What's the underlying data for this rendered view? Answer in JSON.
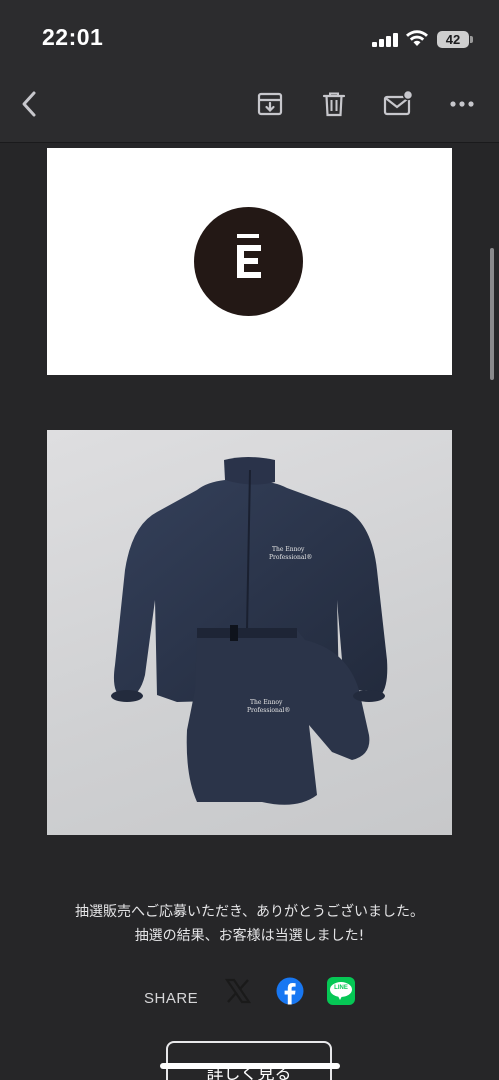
{
  "status_bar": {
    "time": "22:01",
    "battery_level": "42"
  },
  "toolbar": {
    "back_icon": "chevron-left-icon",
    "archive_icon": "archive-download-icon",
    "delete_icon": "trash-icon",
    "mark_unread_icon": "mail-unread-icon",
    "more_icon": "more-dots-icon"
  },
  "email": {
    "logo_letter": "Ē",
    "product_photo": {
      "patch_text_jacket": [
        "The Ennoy",
        "Professional®"
      ],
      "patch_text_pants": [
        "The Ennoy",
        "Professional®"
      ]
    },
    "message_line1": "抽選販売へご応募いただき、ありがとうございました。",
    "message_line2": "抽選の結果、お客様は当選しました!",
    "share_label": "SHARE",
    "share_x_icon": "x-logo-icon",
    "share_facebook_icon": "facebook-icon",
    "share_line_icon": "line-icon",
    "line_text": "LINE",
    "detail_button": "詳しく見る"
  },
  "colors": {
    "background": "#262628",
    "toolbar": "#2c2c2e",
    "facebook": "#1877f2",
    "line": "#06c755",
    "logo_circle": "#231815",
    "garment": "#2a3348"
  }
}
